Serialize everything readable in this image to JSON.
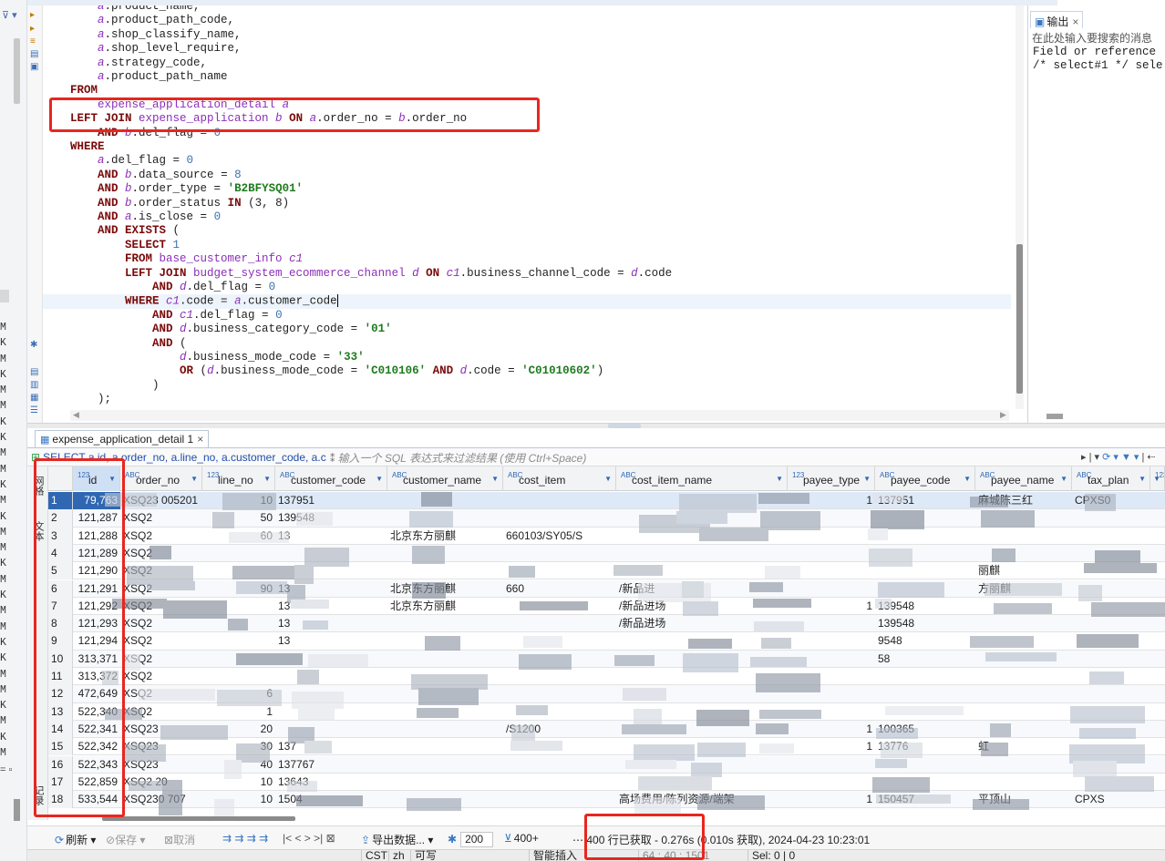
{
  "editor": {
    "lines": [
      [
        [
          "    ",
          "id"
        ],
        [
          "a",
          "al"
        ],
        [
          ".product_name,",
          "id"
        ]
      ],
      [
        [
          "    ",
          "id"
        ],
        [
          "a",
          "al"
        ],
        [
          ".product_path_code,",
          "id"
        ]
      ],
      [
        [
          "    ",
          "id"
        ],
        [
          "a",
          "al"
        ],
        [
          ".shop_classify_name,",
          "id"
        ]
      ],
      [
        [
          "    ",
          "id"
        ],
        [
          "a",
          "al"
        ],
        [
          ".shop_level_require,",
          "id"
        ]
      ],
      [
        [
          "    ",
          "id"
        ],
        [
          "a",
          "al"
        ],
        [
          ".strategy_code,",
          "id"
        ]
      ],
      [
        [
          "    ",
          "id"
        ],
        [
          "a",
          "al"
        ],
        [
          ".product_path_name",
          "id"
        ]
      ],
      [
        [
          "FROM",
          "kw"
        ]
      ],
      [
        [
          "    ",
          "id"
        ],
        [
          "expense_application_detail ",
          "tb"
        ],
        [
          "a",
          "al"
        ]
      ],
      [
        [
          "LEFT JOIN ",
          "kw"
        ],
        [
          "expense_application ",
          "tb"
        ],
        [
          "b",
          "al"
        ],
        [
          " ON ",
          "kw"
        ],
        [
          "a",
          "al"
        ],
        [
          ".order_no = ",
          "id"
        ],
        [
          "b",
          "al"
        ],
        [
          ".order_no",
          "id"
        ]
      ],
      [
        [
          "    ",
          "id"
        ],
        [
          "AND ",
          "kw"
        ],
        [
          "b",
          "al"
        ],
        [
          ".del_flag = ",
          "id"
        ],
        [
          "0",
          "num"
        ]
      ],
      [
        [
          "WHERE",
          "kw"
        ]
      ],
      [
        [
          "    ",
          "id"
        ],
        [
          "a",
          "al"
        ],
        [
          ".del_flag = ",
          "id"
        ],
        [
          "0",
          "num"
        ]
      ],
      [
        [
          "    ",
          "id"
        ],
        [
          "AND ",
          "kw"
        ],
        [
          "b",
          "al"
        ],
        [
          ".data_source = ",
          "id"
        ],
        [
          "8",
          "num"
        ]
      ],
      [
        [
          "    ",
          "id"
        ],
        [
          "AND ",
          "kw"
        ],
        [
          "b",
          "al"
        ],
        [
          ".order_type = ",
          "id"
        ],
        [
          "'B2BFYSQ01'",
          "str"
        ]
      ],
      [
        [
          "    ",
          "id"
        ],
        [
          "AND ",
          "kw"
        ],
        [
          "b",
          "al"
        ],
        [
          ".order_status ",
          "id"
        ],
        [
          "IN ",
          "kw"
        ],
        [
          "(3, 8)",
          "id"
        ]
      ],
      [
        [
          "    ",
          "id"
        ],
        [
          "AND ",
          "kw"
        ],
        [
          "a",
          "al"
        ],
        [
          ".is_close = ",
          "id"
        ],
        [
          "0",
          "num"
        ]
      ],
      [
        [
          "    ",
          "id"
        ],
        [
          "AND EXISTS ",
          "kw"
        ],
        [
          "(",
          "id"
        ]
      ],
      [
        [
          "        ",
          "id"
        ],
        [
          "SELECT ",
          "kw"
        ],
        [
          "1",
          "num"
        ]
      ],
      [
        [
          "        ",
          "id"
        ],
        [
          "FROM ",
          "kw"
        ],
        [
          "base_customer_info ",
          "tb"
        ],
        [
          "c1",
          "al"
        ]
      ],
      [
        [
          "        ",
          "id"
        ],
        [
          "LEFT JOIN ",
          "kw"
        ],
        [
          "budget_system_ecommerce_channel ",
          "tb"
        ],
        [
          "d",
          "al"
        ],
        [
          " ON ",
          "kw"
        ],
        [
          "c1",
          "al"
        ],
        [
          ".business_channel_code = ",
          "id"
        ],
        [
          "d",
          "al"
        ],
        [
          ".code",
          "id"
        ]
      ],
      [
        [
          "            ",
          "id"
        ],
        [
          "AND ",
          "kw"
        ],
        [
          "d",
          "al"
        ],
        [
          ".del_flag = ",
          "id"
        ],
        [
          "0",
          "num"
        ]
      ],
      [
        [
          "        ",
          "id"
        ],
        [
          "WHERE ",
          "kw"
        ],
        [
          "c1",
          "al"
        ],
        [
          ".code = ",
          "id"
        ],
        [
          "a",
          "al"
        ],
        [
          ".customer_code",
          "id"
        ]
      ],
      [
        [
          "            ",
          "id"
        ],
        [
          "AND ",
          "kw"
        ],
        [
          "c1",
          "al"
        ],
        [
          ".del_flag = ",
          "id"
        ],
        [
          "0",
          "num"
        ]
      ],
      [
        [
          "            ",
          "id"
        ],
        [
          "AND ",
          "kw"
        ],
        [
          "d",
          "al"
        ],
        [
          ".business_category_code = ",
          "id"
        ],
        [
          "'01'",
          "str"
        ]
      ],
      [
        [
          "            ",
          "id"
        ],
        [
          "AND ",
          "kw"
        ],
        [
          "(",
          "id"
        ]
      ],
      [
        [
          "                ",
          "id"
        ],
        [
          "d",
          "al"
        ],
        [
          ".business_mode_code = ",
          "id"
        ],
        [
          "'33'",
          "str"
        ]
      ],
      [
        [
          "                ",
          "id"
        ],
        [
          "OR ",
          "kw"
        ],
        [
          "(",
          "id"
        ],
        [
          "d",
          "al"
        ],
        [
          ".business_mode_code = ",
          "id"
        ],
        [
          "'C010106'",
          "str"
        ],
        [
          " AND ",
          "kw"
        ],
        [
          "d",
          "al"
        ],
        [
          ".code = ",
          "id"
        ],
        [
          "'C01010602'",
          "str"
        ],
        [
          ")",
          "id"
        ]
      ],
      [
        [
          "            ",
          "id"
        ],
        [
          ")",
          "id"
        ]
      ],
      [
        [
          "    ",
          "id"
        ],
        [
          ");",
          "id"
        ]
      ]
    ]
  },
  "output": {
    "tab_label": "输出",
    "search_placeholder": "在此处输入要搜索的消息",
    "messages": [
      "Field or reference",
      "/* select#1 */ sele"
    ]
  },
  "left_strip": {
    "labels": [
      "M",
      "K",
      "M",
      "K",
      "M",
      "M",
      "K",
      "K",
      "M",
      "M",
      "K",
      "M",
      "K",
      "M",
      "M",
      "K",
      "M",
      "K",
      "M",
      "M",
      "K",
      "K",
      "M",
      "M",
      "K",
      "M",
      "K",
      "M"
    ],
    "bottom_glyph": "= ▫"
  },
  "results": {
    "tab_label": "expense_application_detail 1",
    "query_text": "SELECT a.id, a.order_no, a.line_no, a.customer_code, a.c",
    "filter_placeholder": "输入一个 SQL 表达式来过滤结果 (使用 Ctrl+Space)",
    "side_tabs": [
      "网格",
      "文本",
      "记录"
    ],
    "columns": [
      {
        "type": "123",
        "name": "id"
      },
      {
        "type": "ABC",
        "name": "order_no"
      },
      {
        "type": "123",
        "name": "line_no"
      },
      {
        "type": "ABC",
        "name": "customer_code"
      },
      {
        "type": "ABC",
        "name": "customer_name"
      },
      {
        "type": "ABC",
        "name": "cost_item"
      },
      {
        "type": "ABC",
        "name": "cost_item_name"
      },
      {
        "type": "123",
        "name": "payee_type"
      },
      {
        "type": "ABC",
        "name": "payee_code"
      },
      {
        "type": "ABC",
        "name": "payee_name"
      },
      {
        "type": "ABC",
        "name": "tax_plan"
      },
      {
        "type": "123",
        "name": ""
      }
    ],
    "rows": [
      {
        "n": "1",
        "id": "79,763",
        "order_no": "XSQ23 005201",
        "line_no": "10",
        "customer_code": "137951",
        "customer_name": "",
        "cost_item": "",
        "cost_item_name": "",
        "payee_type": "1",
        "payee_code": "137951",
        "payee_name": "麻城陈三红",
        "tax_plan": "CPXS0"
      },
      {
        "n": "2",
        "id": "121,287",
        "order_no": "XSQ2",
        "line_no": "50",
        "customer_code": "139548",
        "customer_name": "",
        "cost_item": "",
        "cost_item_name": "",
        "payee_type": "",
        "payee_code": "",
        "payee_name": "",
        "tax_plan": ""
      },
      {
        "n": "3",
        "id": "121,288",
        "order_no": "XSQ2",
        "line_no": "60",
        "customer_code": "13",
        "customer_name": "北京东方丽麒",
        "cost_item": "660103/SY05/S",
        "cost_item_name": "",
        "payee_type": "",
        "payee_code": "",
        "payee_name": "",
        "tax_plan": ""
      },
      {
        "n": "4",
        "id": "121,289",
        "order_no": "XSQ2",
        "line_no": "",
        "customer_code": "",
        "customer_name": "",
        "cost_item": "",
        "cost_item_name": "",
        "payee_type": "",
        "payee_code": "",
        "payee_name": "",
        "tax_plan": ""
      },
      {
        "n": "5",
        "id": "121,290",
        "order_no": "XSQ2",
        "line_no": "",
        "customer_code": "",
        "customer_name": "",
        "cost_item": "",
        "cost_item_name": "",
        "payee_type": "",
        "payee_code": "",
        "payee_name": "丽麒",
        "tax_plan": ""
      },
      {
        "n": "6",
        "id": "121,291",
        "order_no": "XSQ2",
        "line_no": "90",
        "customer_code": "13",
        "customer_name": "北京东方丽麒",
        "cost_item": "660",
        "cost_item_name": "/新品进",
        "payee_type": "",
        "payee_code": "",
        "payee_name": "方丽麒",
        "tax_plan": ""
      },
      {
        "n": "7",
        "id": "121,292",
        "order_no": "XSQ2",
        "line_no": "",
        "customer_code": "13",
        "customer_name": "北京东方丽麒",
        "cost_item": "",
        "cost_item_name": "/新品进场",
        "payee_type": "1",
        "payee_code": "139548",
        "payee_name": "",
        "tax_plan": ""
      },
      {
        "n": "8",
        "id": "121,293",
        "order_no": "XSQ2",
        "line_no": "",
        "customer_code": "13",
        "customer_name": "",
        "cost_item": "",
        "cost_item_name": "/新品进场",
        "payee_type": "",
        "payee_code": "139548",
        "payee_name": "",
        "tax_plan": ""
      },
      {
        "n": "9",
        "id": "121,294",
        "order_no": "XSQ2",
        "line_no": "",
        "customer_code": "13",
        "customer_name": "",
        "cost_item": "",
        "cost_item_name": "",
        "payee_type": "",
        "payee_code": "9548",
        "payee_name": "",
        "tax_plan": ""
      },
      {
        "n": "10",
        "id": "313,371",
        "order_no": "XSQ2",
        "line_no": "",
        "customer_code": "",
        "customer_name": "",
        "cost_item": "",
        "cost_item_name": "",
        "payee_type": "",
        "payee_code": "58",
        "payee_name": "",
        "tax_plan": ""
      },
      {
        "n": "11",
        "id": "313,372",
        "order_no": "XSQ2",
        "line_no": "",
        "customer_code": "",
        "customer_name": "",
        "cost_item": "",
        "cost_item_name": "",
        "payee_type": "",
        "payee_code": "",
        "payee_name": "",
        "tax_plan": ""
      },
      {
        "n": "12",
        "id": "472,649",
        "order_no": "XSQ2",
        "line_no": "6",
        "customer_code": "",
        "customer_name": "",
        "cost_item": "",
        "cost_item_name": "",
        "payee_type": "",
        "payee_code": "",
        "payee_name": "",
        "tax_plan": ""
      },
      {
        "n": "13",
        "id": "522,340",
        "order_no": "XSQ2",
        "line_no": "1",
        "customer_code": "",
        "customer_name": "",
        "cost_item": "",
        "cost_item_name": "",
        "payee_type": "",
        "payee_code": "",
        "payee_name": "",
        "tax_plan": ""
      },
      {
        "n": "14",
        "id": "522,341",
        "order_no": "XSQ23",
        "line_no": "20",
        "customer_code": "",
        "customer_name": "",
        "cost_item": "/S1200",
        "cost_item_name": "",
        "payee_type": "1",
        "payee_code": "100365",
        "payee_name": "",
        "tax_plan": ""
      },
      {
        "n": "15",
        "id": "522,342",
        "order_no": "XSQ23",
        "line_no": "30",
        "customer_code": "137",
        "customer_name": "",
        "cost_item": "",
        "cost_item_name": "",
        "payee_type": "1",
        "payee_code": "13776",
        "payee_name": "虹",
        "tax_plan": ""
      },
      {
        "n": "16",
        "id": "522,343",
        "order_no": "XSQ23",
        "line_no": "40",
        "customer_code": "137767",
        "customer_name": "",
        "cost_item": "",
        "cost_item_name": "",
        "payee_type": "",
        "payee_code": "",
        "payee_name": "",
        "tax_plan": ""
      },
      {
        "n": "17",
        "id": "522,859",
        "order_no": "XSQ2 20",
        "line_no": "10",
        "customer_code": "13643",
        "customer_name": "",
        "cost_item": "",
        "cost_item_name": "",
        "payee_type": "",
        "payee_code": "",
        "payee_name": "",
        "tax_plan": ""
      },
      {
        "n": "18",
        "id": "533,544",
        "order_no": "XSQ230 707",
        "line_no": "10",
        "customer_code": "1504",
        "customer_name": "",
        "cost_item": "",
        "cost_item_name": "高场费用/陈列资源/端架",
        "payee_type": "1",
        "payee_code": "150457",
        "payee_name": "平顶山",
        "tax_plan": "CPXS"
      }
    ]
  },
  "toolbar": {
    "refresh": "刷新",
    "save": "保存",
    "cancel": "取消",
    "export": "导出数据...",
    "fetch_size": "200",
    "fetch_next": "400+",
    "fetch_info": "400 行已获取 - 0.276s (0.010s 获取), 2024-04-23 10:23:01"
  },
  "status": {
    "tz": "CST",
    "lang": "zh",
    "mode": "可写",
    "insert": "智能插入",
    "pos": "64 : 40 : 1501",
    "sel": "Sel: 0 | 0"
  },
  "colors": {
    "highlight": "#e8261f",
    "keyword": "#7a0a0a",
    "alias": "#8b2fb8",
    "string": "#1e7b1e",
    "selection": "#2f67b3"
  }
}
